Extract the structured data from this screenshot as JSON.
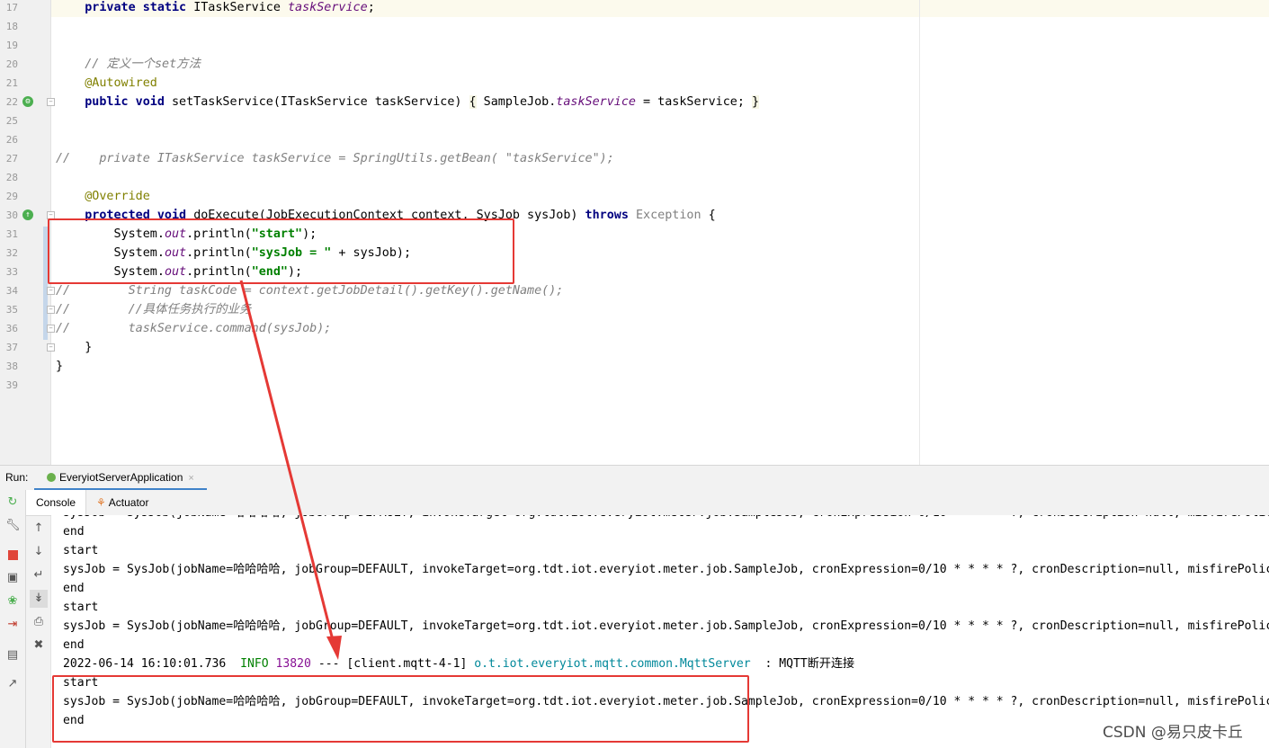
{
  "editor": {
    "lines": [
      {
        "n": "17",
        "indent": "    ",
        "tokens": [
          {
            "t": "private static ",
            "c": "kw"
          },
          {
            "t": "ITaskService ",
            "c": ""
          },
          {
            "t": "taskService",
            "c": "fld"
          },
          {
            "t": ";",
            "c": ""
          }
        ]
      },
      {
        "n": "18",
        "indent": "",
        "tokens": []
      },
      {
        "n": "19",
        "indent": "",
        "tokens": []
      },
      {
        "n": "20",
        "indent": "    ",
        "tokens": [
          {
            "t": "// 定义一个set方法",
            "c": "cmt"
          }
        ]
      },
      {
        "n": "21",
        "indent": "    ",
        "tokens": [
          {
            "t": "@Autowired",
            "c": "ann"
          }
        ]
      },
      {
        "n": "22",
        "indent": "    ",
        "tokens": [
          {
            "t": "public void ",
            "c": "kw"
          },
          {
            "t": "setTaskService(ITaskService taskService) ",
            "c": ""
          },
          {
            "t": "{",
            "c": "br"
          },
          {
            "t": " SampleJob.",
            "c": ""
          },
          {
            "t": "taskService",
            "c": "fld"
          },
          {
            "t": " = taskService; ",
            "c": ""
          },
          {
            "t": "}",
            "c": "br"
          }
        ]
      },
      {
        "n": "25",
        "indent": "",
        "tokens": []
      },
      {
        "n": "26",
        "indent": "",
        "tokens": []
      },
      {
        "n": "27",
        "indent": "",
        "tokens": [
          {
            "t": "//    private ITaskService taskService = SpringUtils.getBean( \"taskService\");",
            "c": "cmt"
          }
        ]
      },
      {
        "n": "28",
        "indent": "",
        "tokens": []
      },
      {
        "n": "29",
        "indent": "    ",
        "tokens": [
          {
            "t": "@Override",
            "c": "ann"
          }
        ]
      },
      {
        "n": "30",
        "indent": "    ",
        "tokens": [
          {
            "t": "protected void ",
            "c": "kw"
          },
          {
            "t": "doExecute(JobExecutionContext context, SysJob sysJob) ",
            "c": ""
          },
          {
            "t": "throws ",
            "c": "kw"
          },
          {
            "t": "Exception",
            "c": "gray"
          },
          {
            "t": " {",
            "c": ""
          }
        ]
      },
      {
        "n": "31",
        "indent": "        ",
        "tokens": [
          {
            "t": "System.",
            "c": ""
          },
          {
            "t": "out",
            "c": "fld"
          },
          {
            "t": ".println(",
            "c": ""
          },
          {
            "t": "\"start\"",
            "c": "str"
          },
          {
            "t": ");",
            "c": ""
          }
        ]
      },
      {
        "n": "32",
        "indent": "        ",
        "tokens": [
          {
            "t": "System.",
            "c": ""
          },
          {
            "t": "out",
            "c": "fld"
          },
          {
            "t": ".println(",
            "c": ""
          },
          {
            "t": "\"sysJob = \"",
            "c": "str"
          },
          {
            "t": " + sysJob);",
            "c": ""
          }
        ]
      },
      {
        "n": "33",
        "indent": "        ",
        "tokens": [
          {
            "t": "System.",
            "c": ""
          },
          {
            "t": "out",
            "c": "fld"
          },
          {
            "t": ".println(",
            "c": ""
          },
          {
            "t": "\"end\"",
            "c": "str"
          },
          {
            "t": ");",
            "c": ""
          }
        ]
      },
      {
        "n": "34",
        "indent": "",
        "tokens": [
          {
            "t": "//        String taskCode = context.getJobDetail().getKey().getName();",
            "c": "cmt"
          }
        ]
      },
      {
        "n": "35",
        "indent": "",
        "tokens": [
          {
            "t": "//        //具体任务执行的业务",
            "c": "cmt"
          }
        ]
      },
      {
        "n": "36",
        "indent": "",
        "tokens": [
          {
            "t": "//        taskService.command(sysJob);",
            "c": "cmt"
          }
        ]
      },
      {
        "n": "37",
        "indent": "    ",
        "tokens": [
          {
            "t": "}",
            "c": ""
          }
        ]
      },
      {
        "n": "38",
        "indent": "",
        "tokens": [
          {
            "t": "}",
            "c": ""
          }
        ]
      },
      {
        "n": "39",
        "indent": "",
        "tokens": []
      }
    ]
  },
  "run_panel": {
    "label": "Run:",
    "tab_title": "EveryiotServerApplication",
    "tab_close": "×",
    "subtabs": {
      "console": "Console",
      "actuator": "Actuator"
    },
    "left_icons": [
      "rerun-icon",
      "wrench-icon",
      "stop-icon",
      "camera-icon",
      "debug-bug-icon",
      "exit-icon",
      "layout-icon",
      "pin-icon"
    ],
    "mid_icons": [
      "arrow-up-icon",
      "arrow-down-icon",
      "soft-wrap-icon",
      "scroll-to-end-icon",
      "print-icon",
      "trash-icon"
    ]
  },
  "console": {
    "lines": [
      {
        "segments": [
          {
            "t": "sysJob = SysJob(jobName=哈哈哈哈, jobGroup=DEFAULT, invokeTarget=org.tdt.iot.everyiot.meter.job.SampleJob, cronExpression=0/10 * * * * ?, cronDescription=null, misfirePolicy",
            "c": ""
          }
        ]
      },
      {
        "segments": [
          {
            "t": "end",
            "c": ""
          }
        ]
      },
      {
        "segments": [
          {
            "t": "start",
            "c": ""
          }
        ]
      },
      {
        "segments": [
          {
            "t": "sysJob = SysJob(jobName=哈哈哈哈, jobGroup=DEFAULT, invokeTarget=org.tdt.iot.everyiot.meter.job.SampleJob, cronExpression=0/10 * * * * ?, cronDescription=null, misfirePolicy",
            "c": ""
          }
        ]
      },
      {
        "segments": [
          {
            "t": "end",
            "c": ""
          }
        ]
      },
      {
        "segments": [
          {
            "t": "start",
            "c": ""
          }
        ]
      },
      {
        "segments": [
          {
            "t": "sysJob = SysJob(jobName=哈哈哈哈, jobGroup=DEFAULT, invokeTarget=org.tdt.iot.everyiot.meter.job.SampleJob, cronExpression=0/10 * * * * ?, cronDescription=null, misfirePolicy",
            "c": ""
          }
        ]
      },
      {
        "segments": [
          {
            "t": "end",
            "c": ""
          }
        ]
      },
      {
        "segments": [
          {
            "t": "2022-06-14 16:10:01.736  ",
            "c": ""
          },
          {
            "t": "INFO",
            "c": "log-info"
          },
          {
            "t": " ",
            "c": ""
          },
          {
            "t": "13820",
            "c": "log-pid"
          },
          {
            "t": " --- [client.mqtt-4-1] ",
            "c": ""
          },
          {
            "t": "o.t.iot.everyiot.mqtt.common.MqttServer",
            "c": "log-logger"
          },
          {
            "t": "  : MQTT断开连接",
            "c": ""
          }
        ]
      },
      {
        "segments": [
          {
            "t": "start",
            "c": ""
          }
        ]
      },
      {
        "segments": [
          {
            "t": "sysJob = SysJob(jobName=哈哈哈哈, jobGroup=DEFAULT, invokeTarget=org.tdt.iot.everyiot.meter.job.SampleJob, cronExpression=0/10 * * * * ?, cronDescription=null, misfirePolicy",
            "c": ""
          }
        ]
      },
      {
        "segments": [
          {
            "t": "end",
            "c": ""
          }
        ]
      }
    ]
  },
  "watermark": "CSDN @易只皮卡丘",
  "colors": {
    "annotation_red": "#e53935",
    "accent_blue": "#4083c9"
  }
}
